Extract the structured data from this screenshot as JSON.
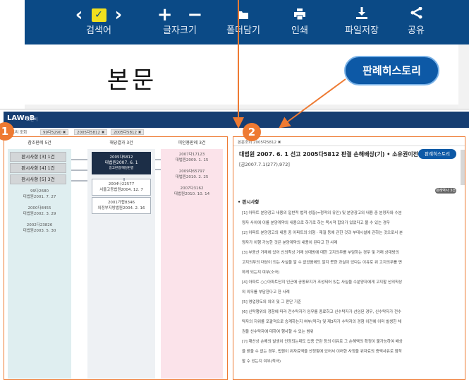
{
  "toolbar": {
    "items": [
      {
        "label": "검색어",
        "icon": "chevrons-check-icon"
      },
      {
        "label": "글자크기",
        "icon": "plus-minus-icon"
      },
      {
        "label": "폴더담기",
        "icon": "folder-icon"
      },
      {
        "label": "인쇄",
        "icon": "print-icon"
      },
      {
        "label": "파일저장",
        "icon": "download-icon"
      },
      {
        "label": "공유",
        "icon": "share-icon"
      }
    ],
    "search_check": "✓"
  },
  "page": {
    "body_title": "본문",
    "history_button": "판례히스토리"
  },
  "panel": {
    "logo": "LAWnB",
    "logo_sub": "로앤비",
    "breadcrumbs": [
      "스토리 조회",
      "99다5290 ✖",
      "2005다5812 ✖",
      "2005다5812 ✖"
    ],
    "col_headers": [
      "참조판례 5건",
      "해당결과 3건",
      "피인용판례 3건"
    ],
    "col1": {
      "categories": [
        "판시사항 [3] 1건",
        "판시사항 [4] 1건",
        "판시사항 [5] 3건"
      ],
      "cases": [
        {
          "no": "99다2680",
          "date": "대법원2001. 7. 27"
        },
        {
          "no": "2000다8455",
          "date": "대법원2002. 3. 29"
        },
        {
          "no": "2002다23826",
          "date": "대법원2003. 5. 30"
        }
      ]
    },
    "col2": {
      "selected": {
        "no": "2005다5812",
        "date": "대법원2007. 6. 1",
        "tag": "참고판결/해당판결"
      },
      "others": [
        {
          "no": "2004나22577",
          "date": "서울고등법원2004. 12. 7"
        },
        {
          "no": "2001가합8346",
          "date": "의정부지방법원2004. 2. 16"
        }
      ]
    },
    "col3": {
      "cases": [
        {
          "no": "2007다17123",
          "date": "대법원2009. 1. 15"
        },
        {
          "no": "2009다65797",
          "date": "대법원2010. 2. 25"
        },
        {
          "no": "2007다3162",
          "date": "대법원2010. 10. 14"
        }
      ]
    },
    "right": {
      "tab": "본문조회 2005다5812 ✖",
      "title": "대법원 2007. 6. 1 선고 2005다5812 판결 손해배상(기) • 소유권이전등기등",
      "source": "[공2007.7.1(277),972]",
      "history_button": "판례히스토리",
      "badge": "판례역사 3건",
      "section": "• 판시사항",
      "lines": [
        "[1] 아파트 분양광고 내용의 일반적 법적 성질(=청약의 유인) 및 분양광고의 내용 중 분양자와 수분",
        "양자 사이에 이를 분양계약의 내용으로 하기로 하는 묵시적 합의가 있었다고 볼 수 있는 경우",
        "[2] 아파트 분양광고의 내용 중 아파트의 외형 · 재질 등에 관한 것과 부대시설에 관하는 것으로서 분",
        "양자가 이행 가능한 것은 분양계약의 내용이 된다고 한 사례",
        "[3] 부동산 거래에 있어 신의칙상 거래 상대방에 대한 고지의무를 부담하는 경우 및 거래 상대방의",
        "고지의무의 대상이 되는 사실을 알 수 없었음에도 알지 못한 과실이 있다는 이유로 위 고지의무를 면",
        "하게 되는지 여부(소극)",
        "[4] 아파트 ○○아파트단지 인근에 공동묘지가 조성되어 있는 사실을 수분양자에게 고지할 신의칙상",
        "의 의무를 부담한다고 한 사례",
        "[5] 영업양도의 의의 및 그 판단 기준",
        "[6] 신탁행위의 정함에 따라 전수탁자가 임무를 종료하고 신수탁자가 선임된 경우, 신수탁자가 전수",
        "탁자의 지위를 포괄적으로 승계하는지 여부(적극) 및 제3자가 수탁자의 경험 이전에 이미 발생한 채",
        "권을 신수탁자에 대하여 행사할 수 있는 범위",
        "[7] 재산상 손해의 발생이 인정되는데도 입증 곤란 등의 이유로 그 손해액의 확정이 불가능하여 배상",
        "을 받을 수 없는 경우, 법원이 위자료액을 산정함에 있어서 이러한 사정을 위자료의 증액사유로 참작",
        "할 수 있는지 여부(적극)"
      ]
    }
  },
  "badges": {
    "one": "1",
    "two": "2"
  },
  "colors": {
    "toolbar": "#0b4a86",
    "accent": "#ee7a32",
    "button": "#0d59a6",
    "appbar": "#163e72"
  }
}
